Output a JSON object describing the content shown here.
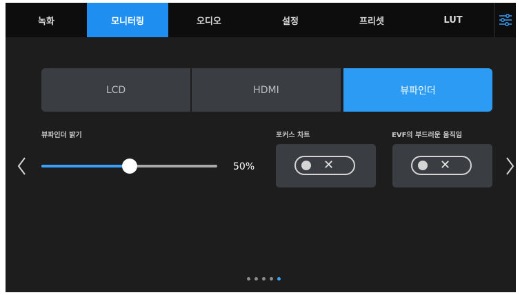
{
  "tabs": [
    {
      "label": "녹화"
    },
    {
      "label": "모니터링",
      "active": true
    },
    {
      "label": "오디오"
    },
    {
      "label": "설정"
    },
    {
      "label": "프리셋"
    },
    {
      "label": "LUT"
    }
  ],
  "menu_icon": "sliders-icon",
  "output_selector": {
    "options": [
      "LCD",
      "HDMI",
      "뷰파인더"
    ],
    "selected": "뷰파인더"
  },
  "brightness": {
    "label": "뷰파인더 밝기",
    "value_text": "50%",
    "value": 0.5
  },
  "focus_chart": {
    "label": "포커스 차트",
    "state": "off"
  },
  "evf_smooth": {
    "label": "EVF의 부드러운 움직임",
    "state": "off"
  },
  "pagination": {
    "count": 5,
    "active_index": 4
  },
  "colors": {
    "accent": "#1f8ef1",
    "background": "#1d1d1d",
    "card": "#3a3d42"
  }
}
